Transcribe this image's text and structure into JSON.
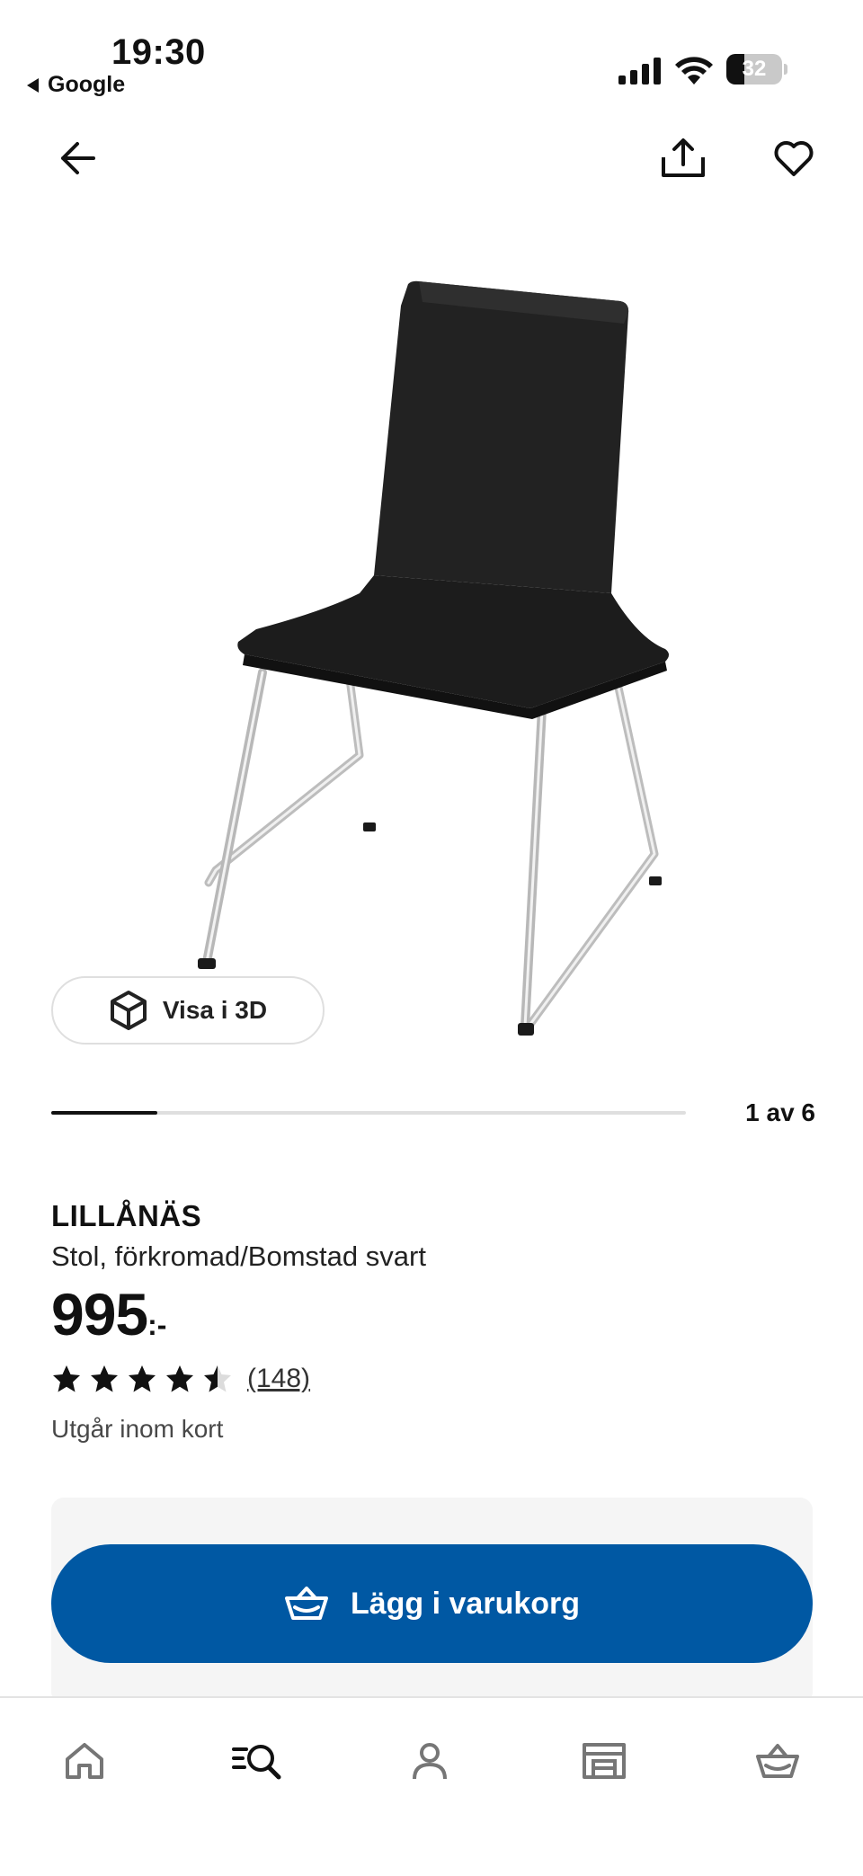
{
  "status_bar": {
    "time": "19:30",
    "back_app": "Google",
    "battery_level": "32",
    "battery_fraction": 0.32
  },
  "top_nav": {
    "icons": [
      "back-arrow-icon",
      "share-icon",
      "heart-icon"
    ]
  },
  "product": {
    "view_3d_label": "Visa i 3D",
    "image_counter": "1 av 6",
    "image_index": 1,
    "image_total": 6,
    "name": "LILLÅNÄS",
    "description": "Stol, förkromad/Bomstad svart",
    "price_amount": "995",
    "price_suffix": ":-",
    "rating_value": 4.5,
    "rating_max": 5,
    "review_count": "(148)",
    "availability": "Utgår inom kort"
  },
  "cart": {
    "add_label": "Lägg i varukorg",
    "button_color": "#0058a3"
  },
  "tab_bar": {
    "tabs": [
      "home-icon",
      "search-icon",
      "profile-icon",
      "store-icon",
      "basket-icon"
    ],
    "active": "search-icon"
  }
}
